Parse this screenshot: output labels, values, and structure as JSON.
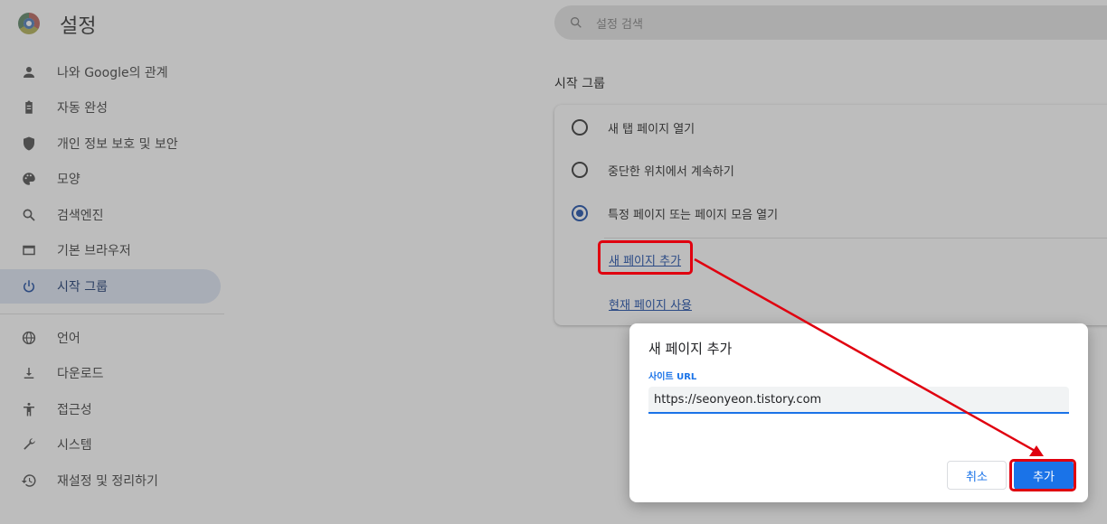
{
  "app": {
    "title": "설정",
    "search_placeholder": "설정 검색"
  },
  "sidebar": {
    "items": [
      {
        "label": "나와 Google의 관계",
        "icon": "person-icon"
      },
      {
        "label": "자동 완성",
        "icon": "clipboard-icon"
      },
      {
        "label": "개인 정보 보호 및 보안",
        "icon": "shield-icon"
      },
      {
        "label": "모양",
        "icon": "palette-icon"
      },
      {
        "label": "검색엔진",
        "icon": "search-icon"
      },
      {
        "label": "기본 브라우저",
        "icon": "browser-icon"
      },
      {
        "label": "시작 그룹",
        "icon": "power-icon",
        "active": true
      },
      {
        "label": "언어",
        "icon": "globe-icon"
      },
      {
        "label": "다운로드",
        "icon": "download-icon"
      },
      {
        "label": "접근성",
        "icon": "accessibility-icon"
      },
      {
        "label": "시스템",
        "icon": "wrench-icon"
      },
      {
        "label": "재설정 및 정리하기",
        "icon": "history-icon"
      }
    ]
  },
  "startup": {
    "section_title": "시작 그룹",
    "options": [
      {
        "label": "새 탭 페이지 열기",
        "checked": false
      },
      {
        "label": "중단한 위치에서 계속하기",
        "checked": false
      },
      {
        "label": "특정 페이지 또는 페이지 모음 열기",
        "checked": true
      }
    ],
    "add_page_link": "새 페이지 추가",
    "use_current_link": "현재 페이지 사용"
  },
  "dialog": {
    "title": "새 페이지 추가",
    "field_label": "사이트 URL",
    "url_value": "https://seonyeon.tistory.com",
    "cancel_label": "취소",
    "add_label": "추가"
  },
  "colors": {
    "accent": "#1a73e8",
    "annotation": "#e0000f"
  }
}
